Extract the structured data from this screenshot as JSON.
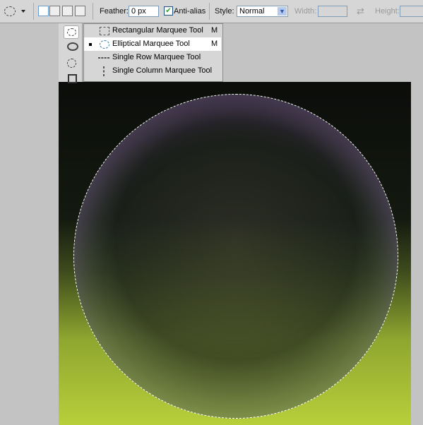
{
  "options_bar": {
    "tool_icon": "elliptical-marquee-icon",
    "feather_label": "Feather:",
    "feather_value": "0 px",
    "antialias_label": "Anti-alias",
    "antialias_checked": true,
    "style_label": "Style:",
    "style_value": "Normal",
    "width_label": "Width:",
    "height_label": "Height:"
  },
  "tool_menu": {
    "items": [
      {
        "label": "Rectangular Marquee Tool",
        "key": "M",
        "icon": "rectangular-marquee-icon",
        "selected": false
      },
      {
        "label": "Elliptical Marquee Tool",
        "key": "M",
        "icon": "elliptical-marquee-icon",
        "selected": true
      },
      {
        "label": "Single Row Marquee Tool",
        "key": "",
        "icon": "single-row-marquee-icon",
        "selected": false
      },
      {
        "label": "Single Column Marquee Tool",
        "key": "",
        "icon": "single-column-marquee-icon",
        "selected": false
      }
    ]
  }
}
